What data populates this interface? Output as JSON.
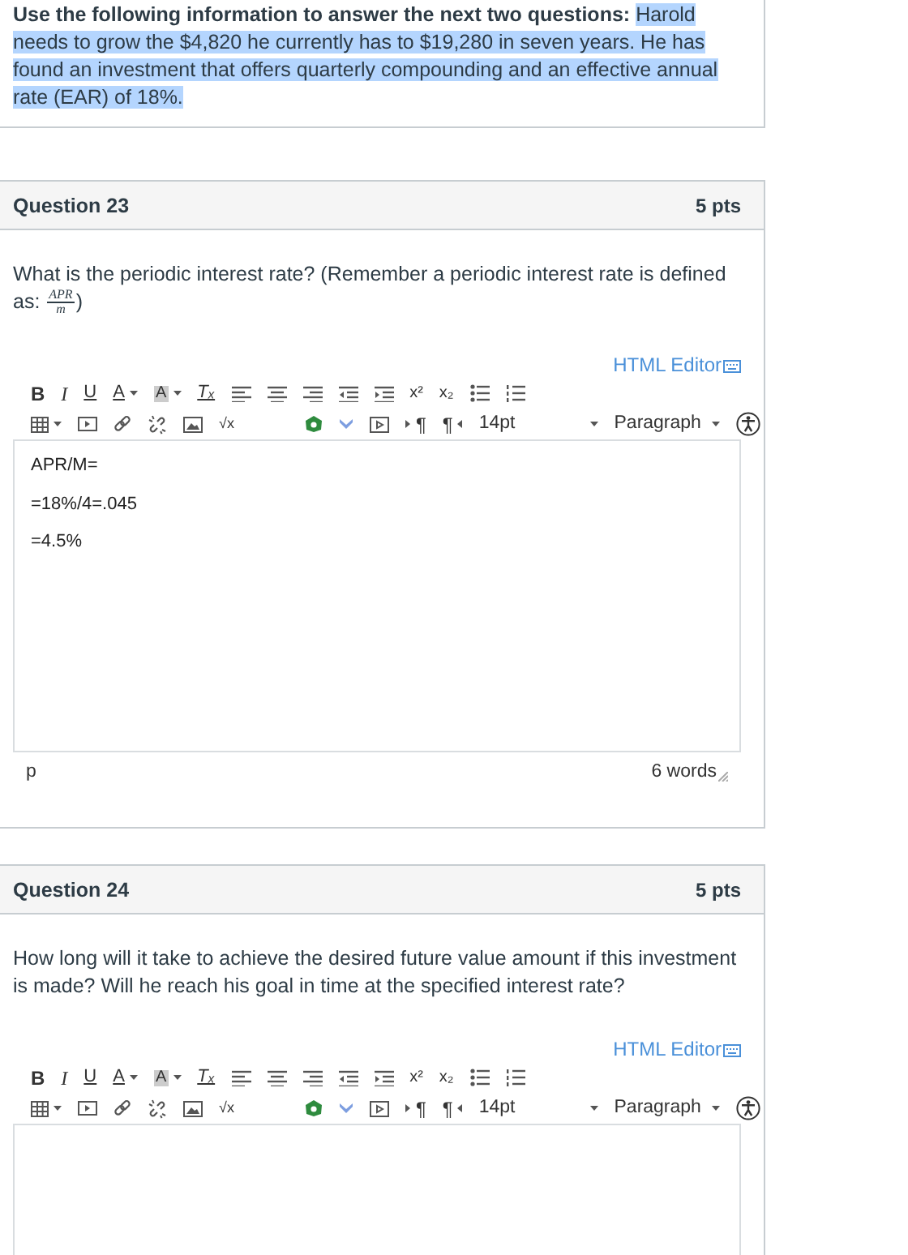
{
  "intro": {
    "lead": "Use the following information to answer the next two questions:",
    "selected_text": "Harold needs to grow the $4,820 he currently has to $19,280 in seven years. He has found an investment that offers quarterly compounding and an effective annual rate (EAR) of 18%."
  },
  "questions": [
    {
      "title": "Question 23",
      "points": "5 pts",
      "prompt": {
        "text": "What is the periodic interest rate? (Remember a periodic interest rate is defined as: ",
        "fraction": {
          "numerator": "APR",
          "denominator": "m"
        },
        "after": ")"
      },
      "editor": {
        "html_editor_link": "HTML Editor",
        "toolbar": [
          [
            {
              "kind": "bold",
              "label": "B"
            },
            {
              "kind": "italic",
              "label": "I"
            },
            {
              "kind": "underline",
              "label": "U"
            },
            {
              "kind": "font-color",
              "label": "A"
            },
            {
              "kind": "background-color",
              "label": "A"
            },
            {
              "kind": "clear-format",
              "label": "Tₓ"
            },
            {
              "kind": "align-left"
            },
            {
              "kind": "align-center"
            },
            {
              "kind": "align-right"
            },
            {
              "kind": "outdent"
            },
            {
              "kind": "indent"
            },
            {
              "kind": "superscript",
              "label": "x²"
            },
            {
              "kind": "subscript",
              "label": "x₂"
            },
            {
              "kind": "bullet-list"
            },
            {
              "kind": "numbered-list"
            }
          ],
          [
            {
              "kind": "table"
            },
            {
              "kind": "media"
            },
            {
              "kind": "link"
            },
            {
              "kind": "unlink"
            },
            {
              "kind": "image"
            },
            {
              "kind": "equation",
              "label": "√x"
            },
            {
              "kind": "app"
            },
            {
              "kind": "expand"
            },
            {
              "kind": "embed"
            },
            {
              "kind": "ltr",
              "label": "¶"
            },
            {
              "kind": "rtl",
              "label": "¶"
            },
            {
              "kind": "select",
              "label": "14pt"
            },
            {
              "kind": "select",
              "label": "Paragraph"
            },
            {
              "kind": "accessibility"
            }
          ]
        ],
        "content": [
          "APR/M=",
          "=18%/4=.045",
          "=4.5%"
        ],
        "status": {
          "path": "p",
          "word_count": "6 words"
        }
      }
    },
    {
      "title": "Question 24",
      "points": "5 pts",
      "prompt": {
        "text": "How long will it take to achieve the desired future value amount if this investment is made? Will he reach his goal in time at the specified interest rate?"
      },
      "editor": {
        "html_editor_link": "HTML Editor",
        "toolbar": [
          [
            {
              "kind": "bold",
              "label": "B"
            },
            {
              "kind": "italic",
              "label": "I"
            },
            {
              "kind": "underline",
              "label": "U"
            },
            {
              "kind": "font-color",
              "label": "A"
            },
            {
              "kind": "background-color",
              "label": "A"
            },
            {
              "kind": "clear-format",
              "label": "Tₓ"
            },
            {
              "kind": "align-left"
            },
            {
              "kind": "align-center"
            },
            {
              "kind": "align-right"
            },
            {
              "kind": "outdent"
            },
            {
              "kind": "indent"
            },
            {
              "kind": "superscript",
              "label": "x²"
            },
            {
              "kind": "subscript",
              "label": "x₂"
            },
            {
              "kind": "bullet-list"
            },
            {
              "kind": "numbered-list"
            }
          ],
          [
            {
              "kind": "table"
            },
            {
              "kind": "media"
            },
            {
              "kind": "link"
            },
            {
              "kind": "unlink"
            },
            {
              "kind": "image"
            },
            {
              "kind": "equation",
              "label": "√x"
            },
            {
              "kind": "app"
            },
            {
              "kind": "expand"
            },
            {
              "kind": "embed"
            },
            {
              "kind": "ltr",
              "label": "¶"
            },
            {
              "kind": "rtl",
              "label": "¶"
            },
            {
              "kind": "select",
              "label": "14pt"
            },
            {
              "kind": "select",
              "label": "Paragraph"
            },
            {
              "kind": "accessibility"
            }
          ]
        ]
      }
    }
  ]
}
